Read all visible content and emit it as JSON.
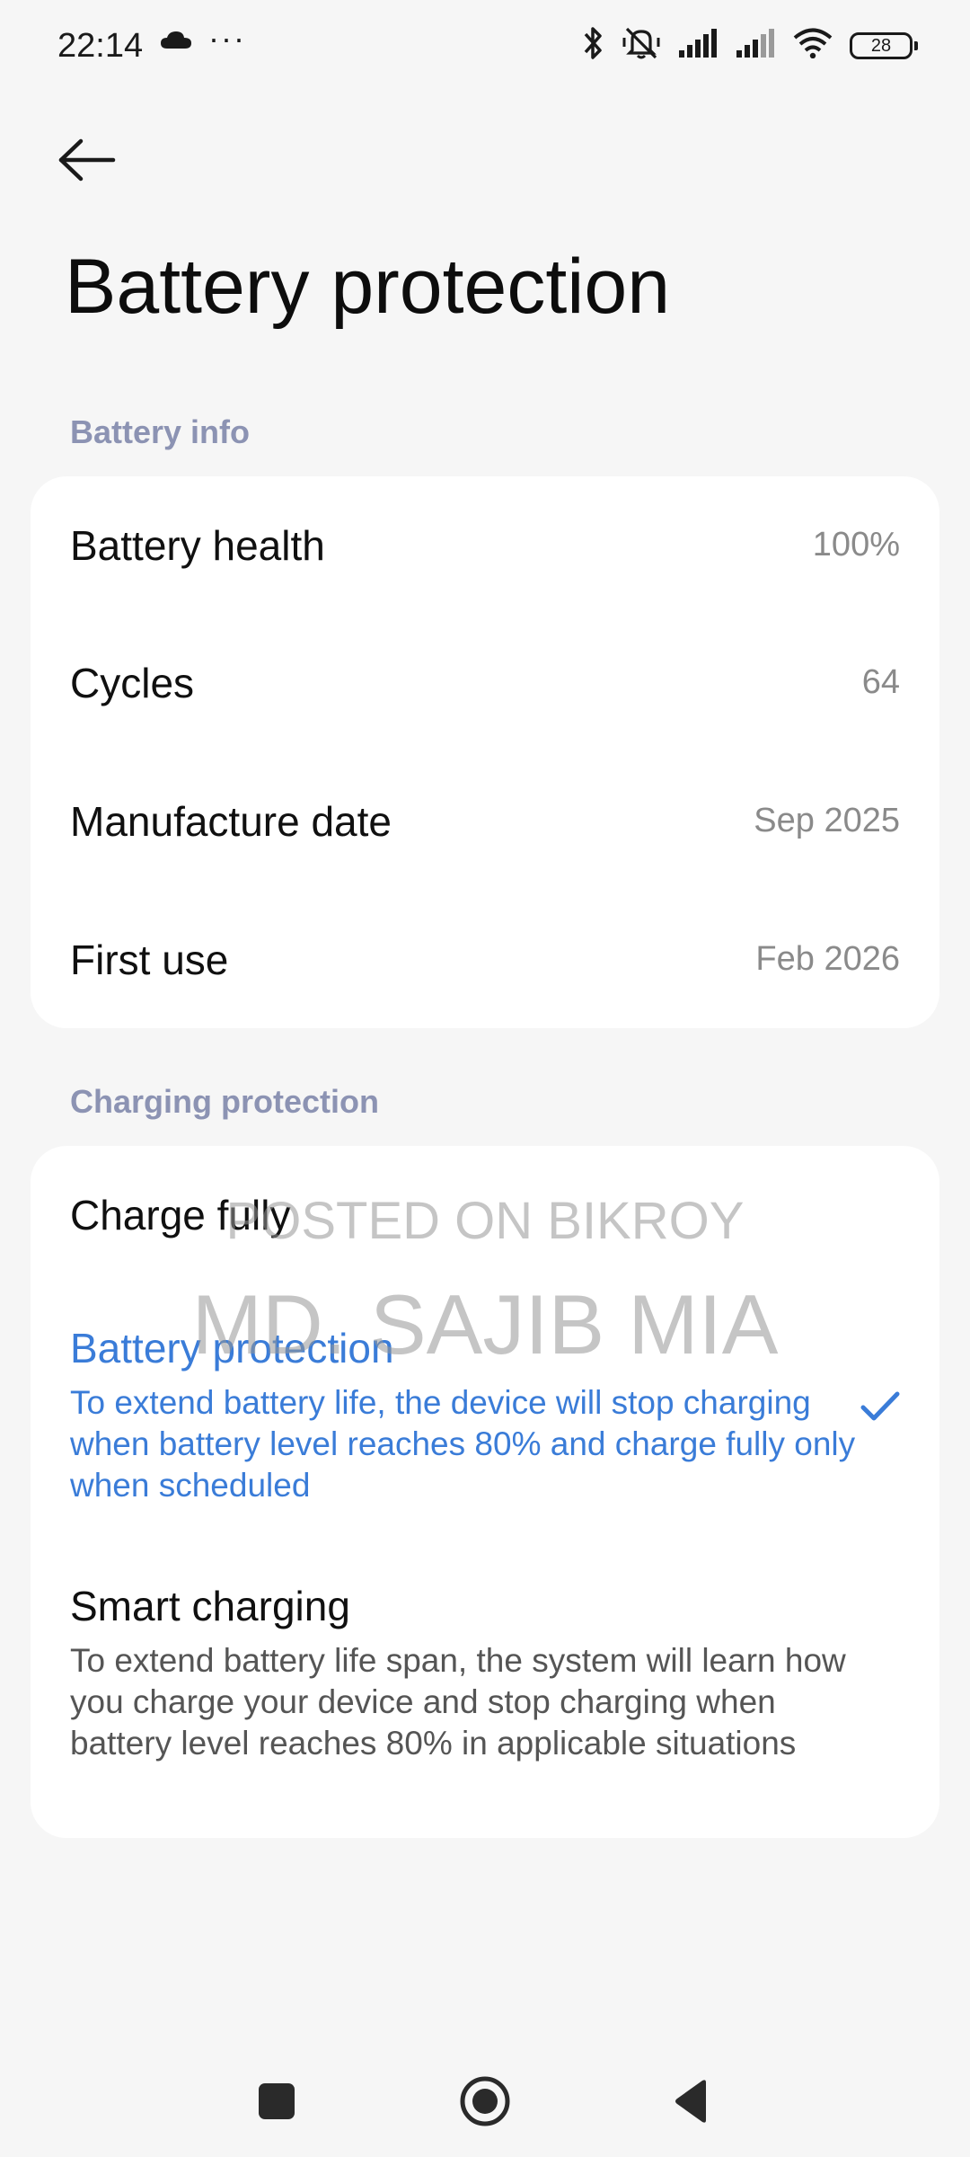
{
  "status_bar": {
    "time": "22:14",
    "more": "···",
    "battery_level": "28"
  },
  "header": {
    "title": "Battery protection"
  },
  "battery_info": {
    "section_label": "Battery info",
    "rows": [
      {
        "label": "Battery health",
        "value": "100%"
      },
      {
        "label": "Cycles",
        "value": "64"
      },
      {
        "label": "Manufacture date",
        "value": "Sep 2025"
      },
      {
        "label": "First use",
        "value": "Feb 2026"
      }
    ]
  },
  "charging_protection": {
    "section_label": "Charging protection",
    "options": [
      {
        "title": "Charge fully",
        "description": "",
        "selected": false
      },
      {
        "title": "Battery protection",
        "description": "To extend battery life, the device will stop charging when battery level reaches 80% and charge fully only when scheduled",
        "selected": true
      },
      {
        "title": "Smart charging",
        "description": "To extend battery life span, the system will learn how you charge your device and stop charging when battery level reaches 80% in applicable situations",
        "selected": false
      }
    ]
  },
  "watermark": {
    "line1": "POSTED ON BIKROY",
    "line2": "MD. SAJIB MIA"
  },
  "colors": {
    "accent": "#3a7cd8",
    "section_header": "#8c93b3",
    "background": "#f6f6f6",
    "card": "#ffffff"
  },
  "icons": {
    "back": "arrow-left-icon",
    "check": "checkmark-icon",
    "nav_recents": "square-icon",
    "nav_home": "circle-icon",
    "nav_back": "triangle-icon"
  }
}
